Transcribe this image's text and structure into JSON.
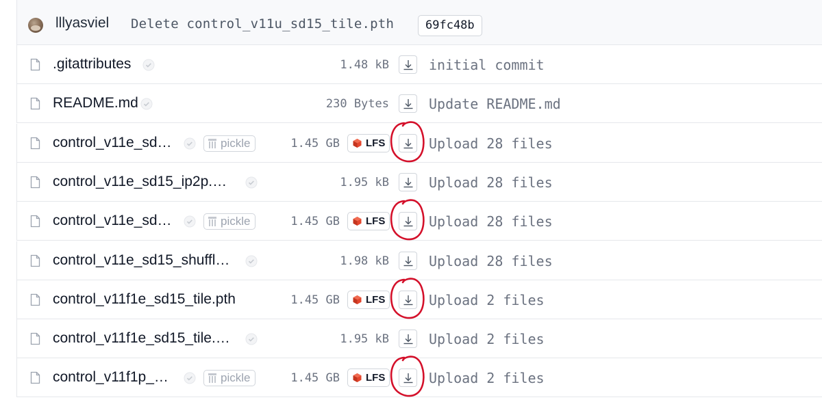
{
  "commit": {
    "author": "lllyasviel",
    "message": "Delete control_v11u_sd15_tile.pth",
    "hash": "69fc48b"
  },
  "files": [
    {
      "name": ".gitattributes",
      "size": "1.48 kB",
      "lfs": false,
      "pickle": false,
      "commit": "initial commit",
      "highlighted": false
    },
    {
      "name": "README.md",
      "size": "230 Bytes",
      "lfs": false,
      "pickle": false,
      "commit": "Update README.md",
      "highlighted": false
    },
    {
      "name": "control_v11e_sd…",
      "size": "1.45 GB",
      "lfs": true,
      "lfs_label": "LFS",
      "pickle": true,
      "pickle_label": "pickle",
      "commit": "Upload 28 files",
      "highlighted": true
    },
    {
      "name": "control_v11e_sd15_ip2p.…",
      "size": "1.95 kB",
      "lfs": false,
      "pickle": false,
      "commit": "Upload 28 files",
      "highlighted": false
    },
    {
      "name": "control_v11e_sd…",
      "size": "1.45 GB",
      "lfs": true,
      "lfs_label": "LFS",
      "pickle": true,
      "pickle_label": "pickle",
      "commit": "Upload 28 files",
      "highlighted": true
    },
    {
      "name": "control_v11e_sd15_shuffl…",
      "size": "1.98 kB",
      "lfs": false,
      "pickle": false,
      "commit": "Upload 28 files",
      "highlighted": false
    },
    {
      "name": "control_v11f1e_sd15_tile.pth",
      "size": "1.45 GB",
      "lfs": true,
      "lfs_label": "LFS",
      "pickle": false,
      "commit": "Upload 2 files",
      "highlighted": true
    },
    {
      "name": "control_v11f1e_sd15_tile.…",
      "size": "1.95 kB",
      "lfs": false,
      "pickle": false,
      "commit": "Upload 2 files",
      "highlighted": false
    },
    {
      "name": "control_v11f1p_…",
      "size": "1.45 GB",
      "lfs": true,
      "lfs_label": "LFS",
      "pickle": true,
      "pickle_label": "pickle",
      "commit": "Upload 2 files",
      "highlighted": true
    }
  ],
  "colors": {
    "annotation": "#d4102a",
    "lfs_cube": "#e4462d",
    "row_border": "#e5e7eb",
    "muted_text": "#6b7280"
  },
  "icons": {
    "file": "file-icon",
    "safe": "shield-check-icon",
    "pickle": "pickle-icon",
    "lfs": "lfs-cube-icon",
    "download": "download-icon"
  }
}
